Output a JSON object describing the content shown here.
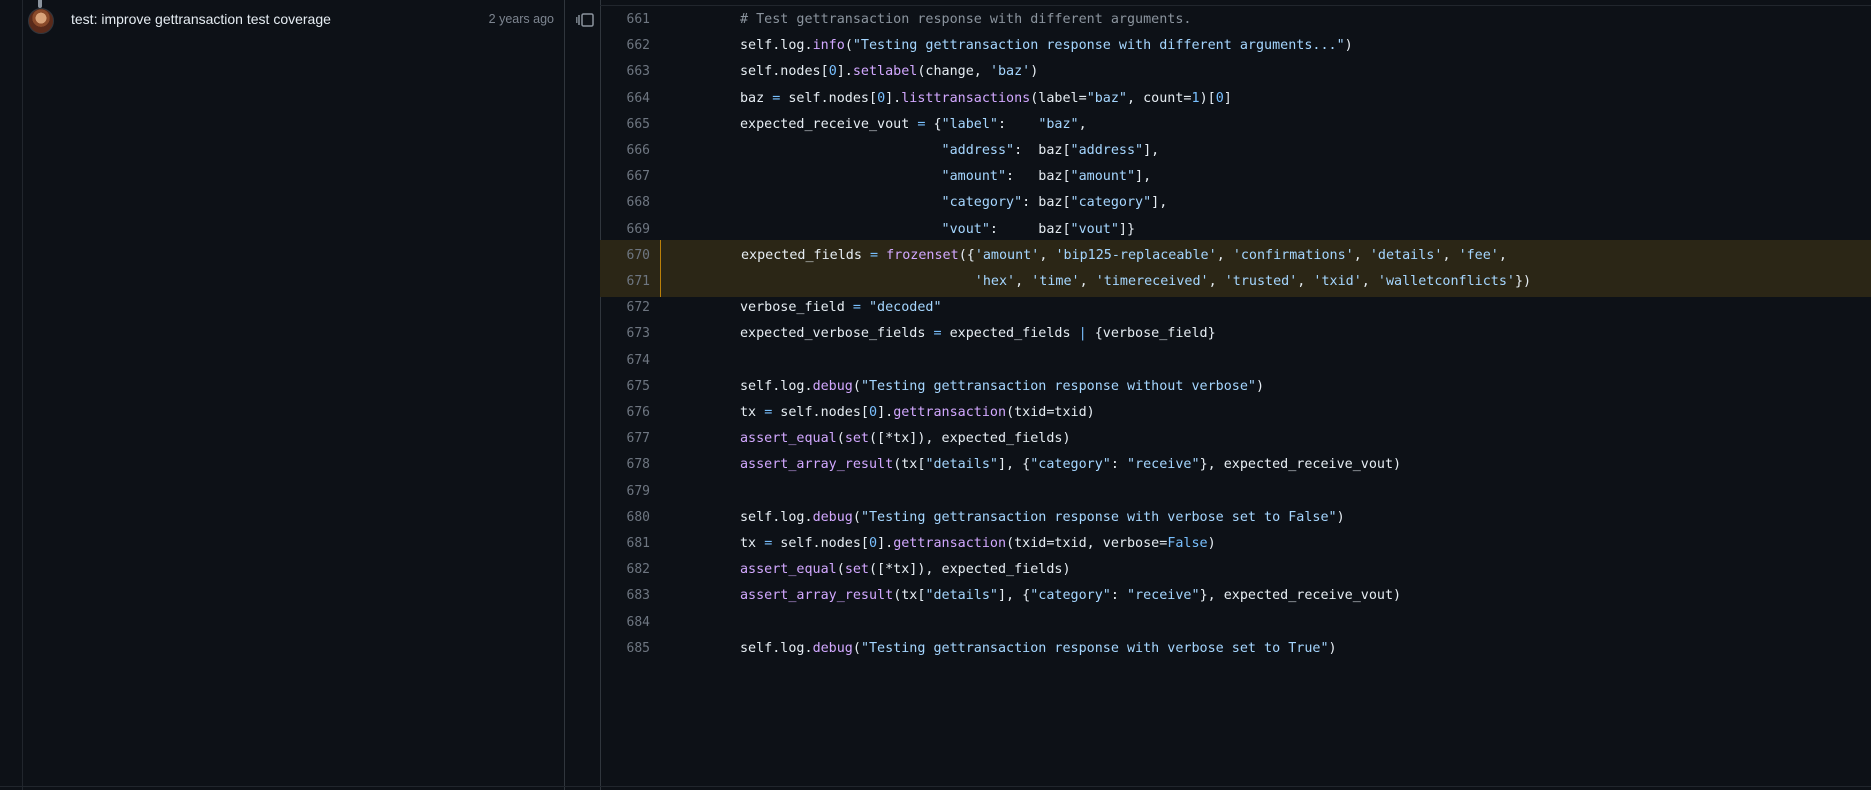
{
  "commit": {
    "message": "test: improve gettransaction test coverage",
    "age": "2 years ago"
  },
  "icons": {
    "avatar": "author-avatar",
    "blame": "blame-reorder-icon"
  },
  "colors": {
    "background": "#0d1117",
    "highlight": "#2b2616",
    "highlight_border": "#bb8009",
    "string": "#a5d6ff",
    "function": "#d2a8ff",
    "number": "#79c0ff",
    "comment": "#8b949e"
  },
  "code": {
    "highlighted_lines": [
      670,
      671
    ],
    "lines": [
      {
        "n": "661",
        "code": "# Test gettransaction response with different arguments."
      },
      {
        "n": "662",
        "code": "self.log.info(\"Testing gettransaction response with different arguments...\")"
      },
      {
        "n": "663",
        "code": "self.nodes[0].setlabel(change, 'baz')"
      },
      {
        "n": "664",
        "code": "baz = self.nodes[0].listtransactions(label=\"baz\", count=1)[0]"
      },
      {
        "n": "665",
        "code": "expected_receive_vout = {\"label\":    \"baz\","
      },
      {
        "n": "666",
        "code": "                         \"address\":  baz[\"address\"],"
      },
      {
        "n": "667",
        "code": "                         \"amount\":   baz[\"amount\"],"
      },
      {
        "n": "668",
        "code": "                         \"category\": baz[\"category\"],"
      },
      {
        "n": "669",
        "code": "                         \"vout\":     baz[\"vout\"]}"
      },
      {
        "n": "670",
        "code": "expected_fields = frozenset({'amount', 'bip125-replaceable', 'confirmations', 'details', 'fee',"
      },
      {
        "n": "671",
        "code": "                             'hex', 'time', 'timereceived', 'trusted', 'txid', 'walletconflicts'})"
      },
      {
        "n": "672",
        "code": "verbose_field = \"decoded\""
      },
      {
        "n": "673",
        "code": "expected_verbose_fields = expected_fields | {verbose_field}"
      },
      {
        "n": "674",
        "code": ""
      },
      {
        "n": "675",
        "code": "self.log.debug(\"Testing gettransaction response without verbose\")"
      },
      {
        "n": "676",
        "code": "tx = self.nodes[0].gettransaction(txid=txid)"
      },
      {
        "n": "677",
        "code": "assert_equal(set([*tx]), expected_fields)"
      },
      {
        "n": "678",
        "code": "assert_array_result(tx[\"details\"], {\"category\": \"receive\"}, expected_receive_vout)"
      },
      {
        "n": "679",
        "code": ""
      },
      {
        "n": "680",
        "code": "self.log.debug(\"Testing gettransaction response with verbose set to False\")"
      },
      {
        "n": "681",
        "code": "tx = self.nodes[0].gettransaction(txid=txid, verbose=False)"
      },
      {
        "n": "682",
        "code": "assert_equal(set([*tx]), expected_fields)"
      },
      {
        "n": "683",
        "code": "assert_array_result(tx[\"details\"], {\"category\": \"receive\"}, expected_receive_vout)"
      },
      {
        "n": "684",
        "code": ""
      },
      {
        "n": "685",
        "code": "self.log.debug(\"Testing gettransaction response with verbose set to True\")"
      }
    ]
  }
}
